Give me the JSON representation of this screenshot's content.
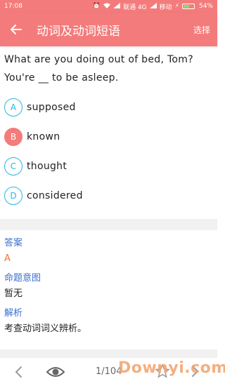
{
  "statusbar": {
    "time": "17:08",
    "carrier1": "联通 4G",
    "carrier2": "移动",
    "battery": "54%",
    "battery_level": 0.54
  },
  "appbar": {
    "title": "动词及动词短语",
    "action": "选择"
  },
  "question": {
    "line1": "What are you doing out of bed, Tom?",
    "line2": "You're __ to be asleep."
  },
  "options": [
    {
      "letter": "A",
      "text": "supposed",
      "selected": false
    },
    {
      "letter": "B",
      "text": "known",
      "selected": true
    },
    {
      "letter": "C",
      "text": "thought",
      "selected": false
    },
    {
      "letter": "D",
      "text": "considered",
      "selected": false
    }
  ],
  "analysis": {
    "answer_label": "答案",
    "answer_value": "A",
    "intent_label": "命题意图",
    "intent_value": "暂无",
    "explain_label": "解析",
    "explain_value": "考查动词词义辨析。"
  },
  "bottombar": {
    "page": "1/104"
  },
  "watermark": "Downyi.com",
  "colors": {
    "primary": "#f47b7b",
    "accent_blue": "#29b6e3",
    "label_blue": "#3b6fcf",
    "answer_orange": "#f0703a"
  }
}
